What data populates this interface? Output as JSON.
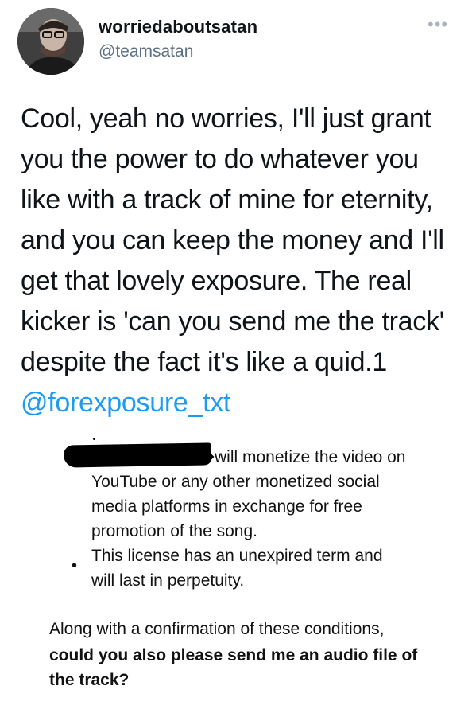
{
  "user": {
    "display_name": "worriedaboutsatan",
    "handle": "@teamsatan"
  },
  "more_icon_glyph": "•••",
  "tweet": {
    "lines": [
      "Cool, yeah no worries, I'll just grant",
      "you the power to do whatever you",
      "like with a track of mine for eternity,",
      "and you can keep the money and I'll",
      "get that lovely exposure. The real",
      "kicker is 'can you send me the track'",
      "despite the fact it's like a quid.1"
    ],
    "mention": "@forexposure_txt"
  },
  "screenshot": {
    "p1": [
      "will monetize the video on",
      "YouTube or any other monetized social",
      "media platforms in exchange for free",
      "promotion of the song."
    ],
    "bullet": "•",
    "p2": [
      "This license has an unexpired term and",
      "will last in perpetuity."
    ],
    "p3": "Along with a confirmation of these conditions,",
    "p3_bold": [
      "could you also please send me an audio file of",
      "the track?"
    ]
  },
  "colors": {
    "mention": "#1d9bf0",
    "handle": "#5b7083",
    "text": "#0f1419"
  }
}
